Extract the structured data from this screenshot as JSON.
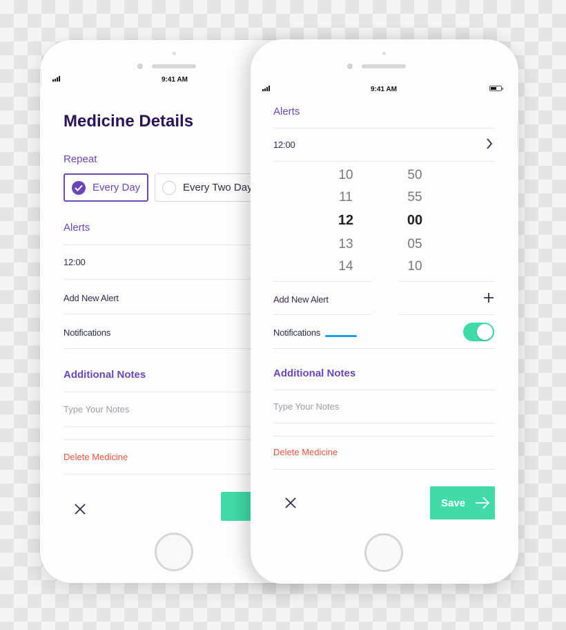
{
  "status_bar": {
    "time": "9:41 AM"
  },
  "left_screen": {
    "title": "Medicine Details",
    "repeat": {
      "label": "Repeat",
      "options": [
        {
          "label": "Every Day",
          "selected": true
        },
        {
          "label": "Every Two Days",
          "visible_text": "Every Two Day",
          "selected": false
        }
      ]
    },
    "alerts": {
      "label": "Alerts",
      "items": [
        "12:00"
      ],
      "add_label": "Add New Alert"
    },
    "notifications_label": "Notifications",
    "notes": {
      "label": "Additional Notes",
      "placeholder": "Type Your Notes"
    },
    "delete_label": "Delete Medicine",
    "close_icon": "close-icon"
  },
  "right_screen": {
    "alerts": {
      "label": "Alerts",
      "time": "12:00",
      "chevron_icon": "chevron-right-icon",
      "picker": {
        "hours": [
          "10",
          "11",
          "12",
          "13",
          "14"
        ],
        "minutes": [
          "50",
          "55",
          "00",
          "05",
          "10"
        ],
        "selected_hour": "12",
        "selected_minute": "00"
      },
      "add_label": "Add New Alert",
      "add_icon": "plus-icon"
    },
    "notifications": {
      "label": "Notifications",
      "enabled": true
    },
    "notes": {
      "label": "Additional Notes",
      "placeholder": "Type Your Notes"
    },
    "delete_label": "Delete Medicine",
    "save_label": "Save",
    "close_icon": "close-icon"
  },
  "colors": {
    "primary_purple": "#6a47b5",
    "title_dark": "#2a1455",
    "accent_green": "#41dba5",
    "danger_red": "#e8533f",
    "link_blue": "#1e9ff2"
  }
}
